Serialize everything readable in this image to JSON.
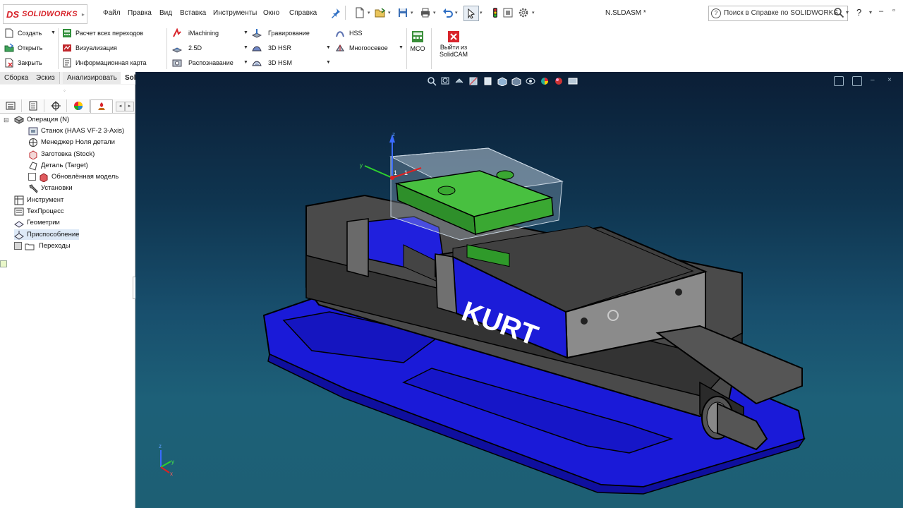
{
  "app": {
    "logo_ds": "DS",
    "logo_name": "SOLIDWORKS",
    "document_title": "N.SLDASM *"
  },
  "menu": {
    "items": [
      "Файл",
      "Правка",
      "Вид",
      "Вставка",
      "Инструменты",
      "Окно",
      "Справка"
    ]
  },
  "help": {
    "placeholder": "Поиск в Справке по SOLIDWORKS",
    "help_label": "?"
  },
  "ribbon": {
    "file_group": [
      "Создать",
      "Открыть",
      "Закрыть"
    ],
    "calc_group": [
      "Расчет всех переходов",
      "Визуализация",
      "Информационная карта"
    ],
    "machining_group": [
      "iMachining",
      "2.5D",
      "Распознавание"
    ],
    "engrave_group": [
      "Гравирование",
      "3D HSR",
      "3D HSM"
    ],
    "hss_group": [
      "HSS",
      "Многоосевое"
    ],
    "mco": "MCO",
    "exit_line1": "Выйти из",
    "exit_line2": "SolidCAM"
  },
  "tabs": [
    "Сборка",
    "Эскиз",
    "Анализировать",
    "SolidCAM Переходы"
  ],
  "tree": {
    "root": "Операция (N)",
    "children": [
      "Станок (HAAS VF-2 3-Axis)",
      "Менеджер Ноля детали",
      "Заготовка (Stock)",
      "Деталь (Target)",
      "Обновлённая модель",
      "Установки"
    ],
    "top_level": [
      "Инструмент",
      "ТехПроцесс",
      "Геометрии",
      "Приспособление",
      "Переходы"
    ]
  },
  "viewport": {
    "brand": "KURT",
    "triad": {
      "x": "x",
      "y": "y",
      "z": "z"
    },
    "coord_marker": "1"
  },
  "colors": {
    "vise_blue": "#1414d6",
    "vise_gray": "#4a4a4a",
    "part_green": "#3aa832",
    "accent_red": "#d8242b"
  },
  "icons": {
    "toolbar": [
      "new-doc-icon",
      "open-icon",
      "save-icon",
      "print-icon",
      "undo-icon",
      "select-icon",
      "traffic-light-icon",
      "gear-icon",
      "pin-icon"
    ],
    "hud": [
      "zoom-fit-icon",
      "zoom-area-icon",
      "previous-view-icon",
      "section-view-icon",
      "view-orientation-icon",
      "display-style-icon",
      "hide-show-icon",
      "appearance-icon",
      "scene-icon",
      "view-settings-icon"
    ]
  }
}
